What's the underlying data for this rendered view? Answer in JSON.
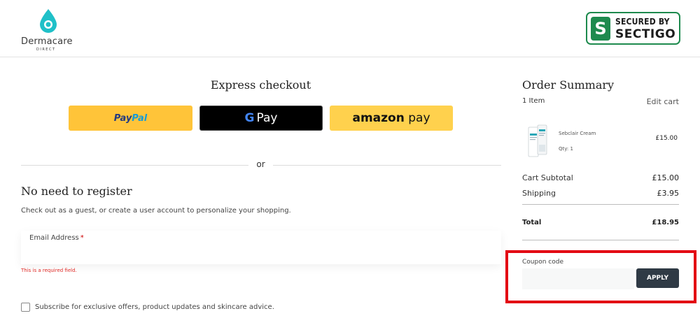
{
  "header": {
    "logo_name": "Dermacare",
    "logo_sub": "DIRECT",
    "badge_line1": "SECURED BY",
    "badge_line2": "SECTIGO",
    "badge_mark": "S"
  },
  "express": {
    "title": "Express checkout",
    "paypal_a": "Pay",
    "paypal_b": "Pal",
    "gpay_g": "G",
    "gpay_text": "Pay",
    "amazon_a": "amazon",
    "amazon_b": " pay"
  },
  "divider_text": "or",
  "guest": {
    "title": "No need to register",
    "subtitle": "Check out as a guest, or create a user account to personalize your shopping.",
    "email_label": "Email Address",
    "required_mark": "*",
    "email_value": "",
    "error": "This is a required field.",
    "subscribe_label": "Subscribe for exclusive offers, product updates and skincare advice."
  },
  "summary": {
    "title": "Order Summary",
    "items_count": "1 Item",
    "edit_cart": "Edit cart",
    "product": {
      "name": "Sebclair Cream",
      "qty": "Qty: 1",
      "price": "£15.00"
    },
    "subtotal_label": "Cart Subtotal",
    "subtotal_value": "£15.00",
    "shipping_label": "Shipping",
    "shipping_value": "£3.95",
    "total_label": "Total",
    "total_value": "£18.95"
  },
  "coupon": {
    "label": "Coupon code",
    "value": "",
    "apply": "APPLY"
  },
  "colors": {
    "brand_teal": "#1fc0c8",
    "sectigo_green": "#1e8a4e",
    "paypal_yellow": "#ffc439",
    "apply_button": "#2f3a45",
    "highlight_red": "#e30613"
  }
}
